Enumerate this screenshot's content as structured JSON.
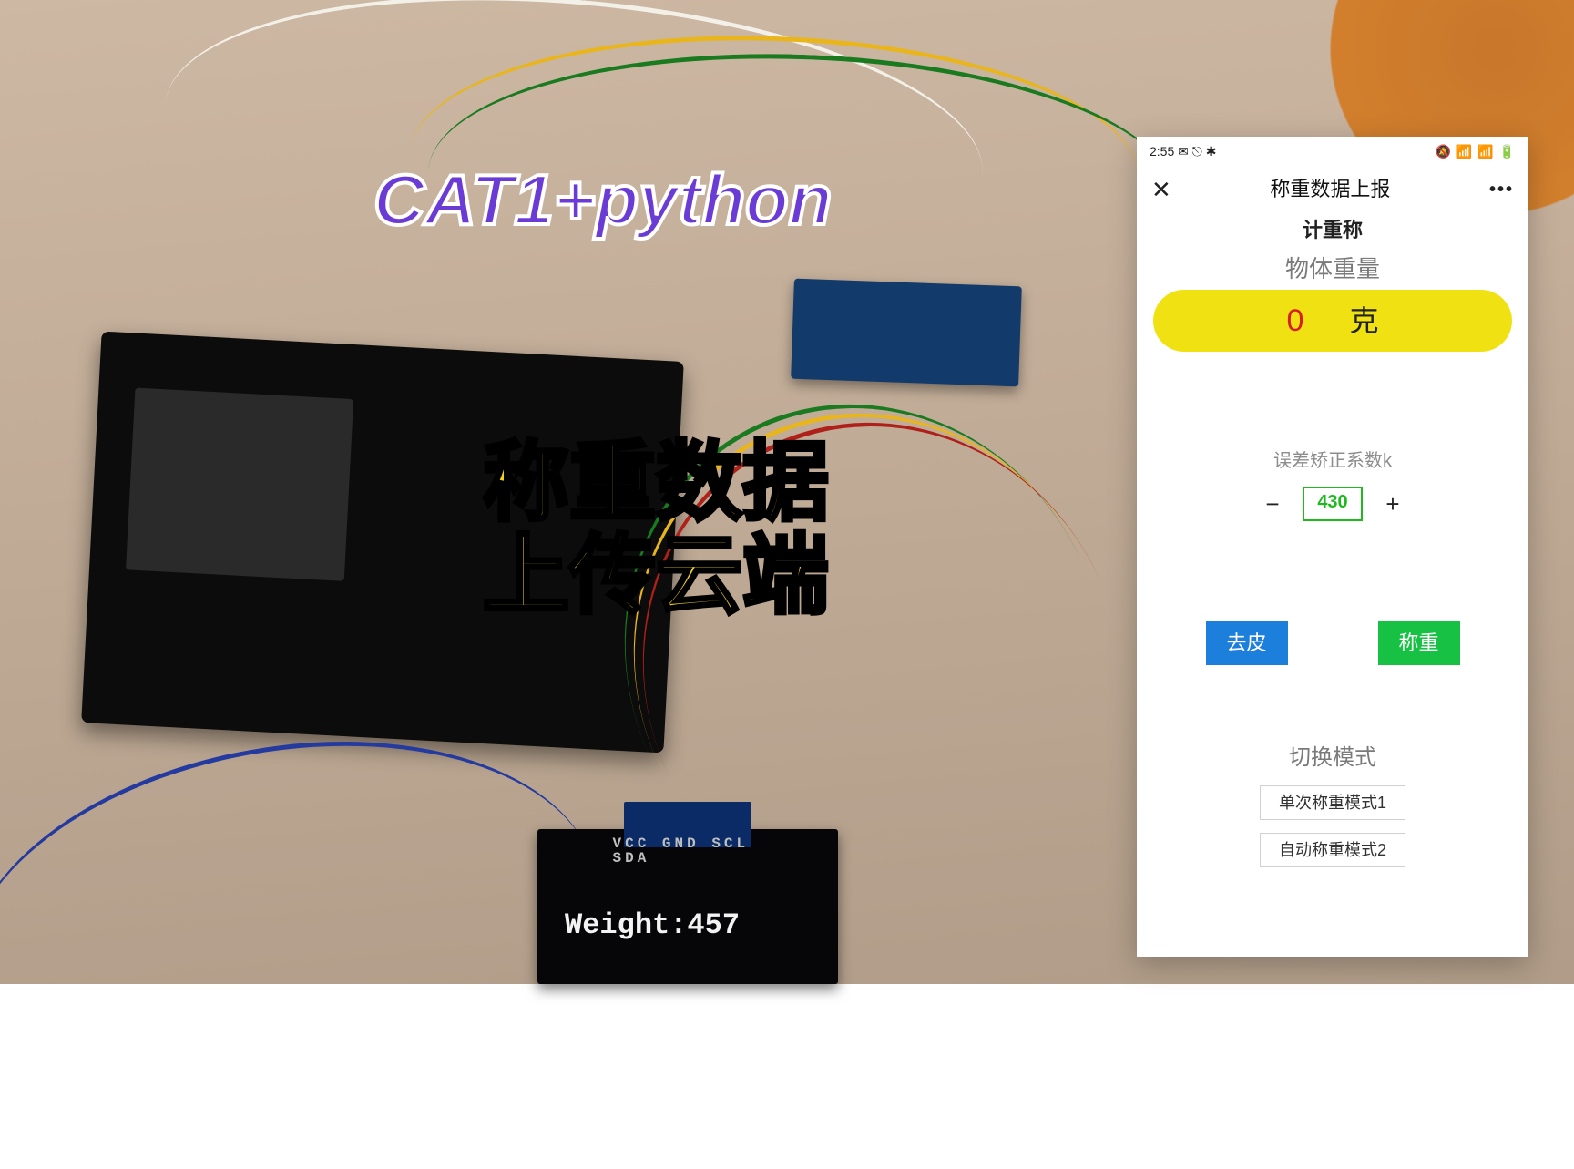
{
  "overlay": {
    "caption1": "CAT1+python",
    "caption2_line1": "称重数据",
    "caption2_line2": "上传云端"
  },
  "oled": {
    "pin_labels": "VCC GND SCL SDA",
    "text": "Weight:457"
  },
  "phone": {
    "status": {
      "time": "2:55",
      "left_icons": "✉ ⎋ ✱",
      "right_icons": "🔕 📶 📶 🔋"
    },
    "titlebar": {
      "close": "✕",
      "title": "称重数据上报",
      "menu": "•••"
    },
    "subtitle": "计重称",
    "weight_label": "物体重量",
    "weight_value": "0",
    "weight_unit": "克",
    "k_label": "误差矫正系数k",
    "k_value": "430",
    "minus": "−",
    "plus": "+",
    "tare_btn": "去皮",
    "weigh_btn": "称重",
    "mode_label": "切换模式",
    "mode1": "单次称重模式1",
    "mode2": "自动称重模式2"
  }
}
